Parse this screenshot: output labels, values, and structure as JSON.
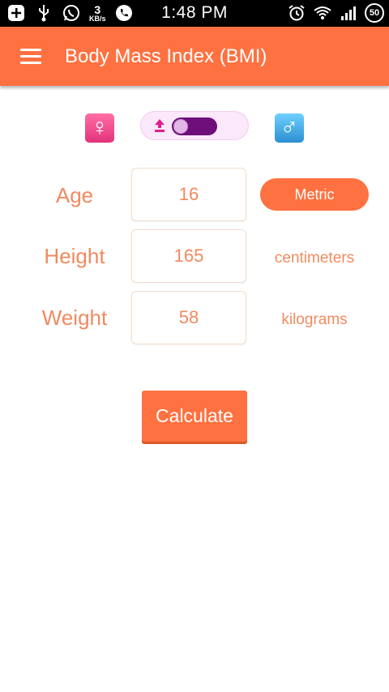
{
  "status_bar": {
    "icons_left": [
      "add-icon",
      "usb-icon",
      "whatsapp-icon",
      "data-rate-icon",
      "phone-icon"
    ],
    "data_rate_value": "3",
    "data_rate_unit": "KB/s",
    "time": "1:48 PM",
    "icons_right": [
      "alarm-icon",
      "wifi-icon",
      "signal-icon",
      "battery-icon"
    ],
    "battery_level": "50"
  },
  "app_bar": {
    "title": "Body Mass Index (BMI)",
    "color": "#ff7140"
  },
  "gender": {
    "female_symbol": "♀",
    "male_symbol": "♂",
    "toggle_selected": "female"
  },
  "form": {
    "age": {
      "label": "Age",
      "value": "16"
    },
    "height": {
      "label": "Height",
      "value": "165",
      "unit": "centimeters"
    },
    "weight": {
      "label": "Weight",
      "value": "58",
      "unit": "kilograms"
    }
  },
  "metric_button": {
    "label": "Metric"
  },
  "calculate_button": {
    "label": "Calculate"
  }
}
